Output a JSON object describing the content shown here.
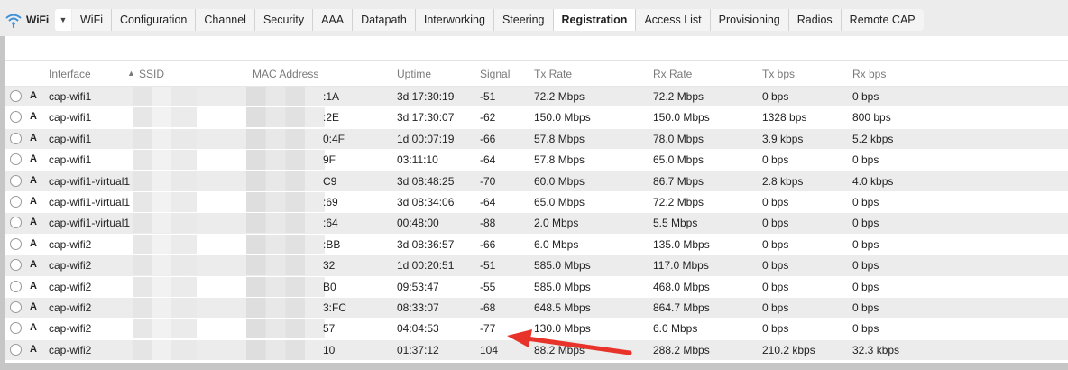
{
  "app": {
    "title": "WiFi"
  },
  "tabs": [
    {
      "label": "WiFi"
    },
    {
      "label": "Configuration"
    },
    {
      "label": "Channel"
    },
    {
      "label": "Security"
    },
    {
      "label": "AAA"
    },
    {
      "label": "Datapath"
    },
    {
      "label": "Interworking"
    },
    {
      "label": "Steering"
    },
    {
      "label": "Registration",
      "active": true
    },
    {
      "label": "Access List"
    },
    {
      "label": "Provisioning"
    },
    {
      "label": "Radios"
    },
    {
      "label": "Remote CAP"
    }
  ],
  "table": {
    "headers": {
      "interface": "Interface",
      "ssid": "SSID",
      "mac": "MAC Address",
      "uptime": "Uptime",
      "signal": "Signal",
      "tx_rate": "Tx Rate",
      "rx_rate": "Rx Rate",
      "tx_bps": "Tx bps",
      "rx_bps": "Rx bps"
    },
    "rows": [
      {
        "flag": "A",
        "interface": "cap-wifi1",
        "mac": ":1A",
        "uptime": "3d 17:30:19",
        "signal": "-51",
        "tx_rate": "72.2 Mbps",
        "rx_rate": "72.2 Mbps",
        "tx_bps": "0 bps",
        "rx_bps": "0 bps"
      },
      {
        "flag": "A",
        "interface": "cap-wifi1",
        "mac": ":2E",
        "uptime": "3d 17:30:07",
        "signal": "-62",
        "tx_rate": "150.0 Mbps",
        "rx_rate": "150.0 Mbps",
        "tx_bps": "1328 bps",
        "rx_bps": "800 bps"
      },
      {
        "flag": "A",
        "interface": "cap-wifi1",
        "mac": "0:4F",
        "uptime": "1d 00:07:19",
        "signal": "-66",
        "tx_rate": "57.8 Mbps",
        "rx_rate": "78.0 Mbps",
        "tx_bps": "3.9 kbps",
        "rx_bps": "5.2 kbps"
      },
      {
        "flag": "A",
        "interface": "cap-wifi1",
        "mac": "9F",
        "uptime": "03:11:10",
        "signal": "-64",
        "tx_rate": "57.8 Mbps",
        "rx_rate": "65.0 Mbps",
        "tx_bps": "0 bps",
        "rx_bps": "0 bps"
      },
      {
        "flag": "A",
        "interface": "cap-wifi1-virtual1",
        "mac": "C9",
        "uptime": "3d 08:48:25",
        "signal": "-70",
        "tx_rate": "60.0 Mbps",
        "rx_rate": "86.7 Mbps",
        "tx_bps": "2.8 kbps",
        "rx_bps": "4.0 kbps"
      },
      {
        "flag": "A",
        "interface": "cap-wifi1-virtual1",
        "mac": ":69",
        "uptime": "3d 08:34:06",
        "signal": "-64",
        "tx_rate": "65.0 Mbps",
        "rx_rate": "72.2 Mbps",
        "tx_bps": "0 bps",
        "rx_bps": "0 bps"
      },
      {
        "flag": "A",
        "interface": "cap-wifi1-virtual1",
        "mac": ":64",
        "uptime": "00:48:00",
        "signal": "-88",
        "tx_rate": "2.0 Mbps",
        "rx_rate": "5.5 Mbps",
        "tx_bps": "0 bps",
        "rx_bps": "0 bps"
      },
      {
        "flag": "A",
        "interface": "cap-wifi2",
        "mac": ":BB",
        "uptime": "3d 08:36:57",
        "signal": "-66",
        "tx_rate": "6.0 Mbps",
        "rx_rate": "135.0 Mbps",
        "tx_bps": "0 bps",
        "rx_bps": "0 bps"
      },
      {
        "flag": "A",
        "interface": "cap-wifi2",
        "mac": "32",
        "uptime": "1d 00:20:51",
        "signal": "-51",
        "tx_rate": "585.0 Mbps",
        "rx_rate": "117.0 Mbps",
        "tx_bps": "0 bps",
        "rx_bps": "0 bps"
      },
      {
        "flag": "A",
        "interface": "cap-wifi2",
        "mac": "B0",
        "uptime": "09:53:47",
        "signal": "-55",
        "tx_rate": "585.0 Mbps",
        "rx_rate": "468.0 Mbps",
        "tx_bps": "0 bps",
        "rx_bps": "0 bps"
      },
      {
        "flag": "A",
        "interface": "cap-wifi2",
        "mac": "3:FC",
        "uptime": "08:33:07",
        "signal": "-68",
        "tx_rate": "648.5 Mbps",
        "rx_rate": "864.7 Mbps",
        "tx_bps": "0 bps",
        "rx_bps": "0 bps"
      },
      {
        "flag": "A",
        "interface": "cap-wifi2",
        "mac": "57",
        "uptime": "04:04:53",
        "signal": "-77",
        "tx_rate": "130.0 Mbps",
        "rx_rate": "6.0 Mbps",
        "tx_bps": "0 bps",
        "rx_bps": "0 bps"
      },
      {
        "flag": "A",
        "interface": "cap-wifi2",
        "mac": "10",
        "uptime": "01:37:12",
        "signal": "104",
        "tx_rate": "88.2 Mbps",
        "rx_rate": "288.2 Mbps",
        "tx_bps": "210.2 kbps",
        "rx_bps": "32.3 kbps"
      }
    ]
  },
  "colors": {
    "annotation_arrow": "#e8332a",
    "wifi_icon": "#3d8fd9",
    "alt_row": "#ececec"
  }
}
